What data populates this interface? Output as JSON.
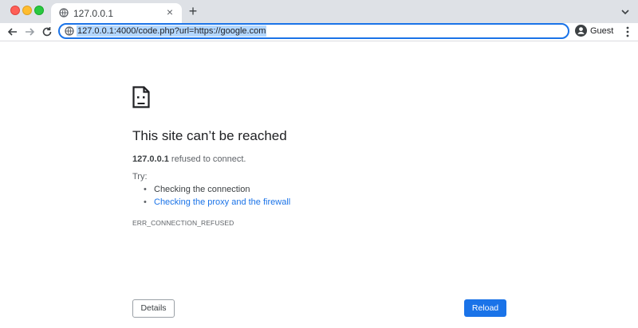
{
  "browser": {
    "tab": {
      "title": "127.0.0.1",
      "icon": "globe-icon"
    },
    "new_tab_label": "+",
    "address": "127.0.0.1:4000/code.php?url=https://google.com",
    "profile_label": "Guest"
  },
  "error": {
    "icon": "sad-file-icon",
    "title": "This site can’t be reached",
    "host": "127.0.0.1",
    "message": " refused to connect.",
    "try_label": "Try:",
    "suggestions": [
      {
        "label": "Checking the connection",
        "is_link": false
      },
      {
        "label": "Checking the proxy and the firewall",
        "is_link": true
      }
    ],
    "code": "ERR_CONNECTION_REFUSED"
  },
  "buttons": {
    "details_label": "Details",
    "reload_label": "Reload"
  },
  "colors": {
    "accent": "#1a73e8",
    "tabstrip": "#dee1e6",
    "selection": "#b3d7ff"
  }
}
